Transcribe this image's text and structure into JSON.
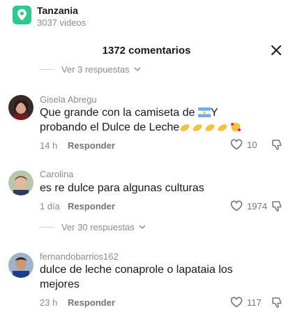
{
  "location": {
    "name": "Tanzania",
    "videos": "3037 videos",
    "icon": "location-pin-icon",
    "accent": "#2ec98f"
  },
  "header": {
    "title": "1372 comentarios",
    "close_icon": "close-icon"
  },
  "replies_top": {
    "label": "Ver 3 respuestas"
  },
  "comments": [
    {
      "username": "Gisela Abregu",
      "text_part1": "Que grande con la camiseta de ",
      "text_part2": "Y",
      "text_line2": "probando el Dulce de Leche",
      "time": "14 h",
      "reply_label": "Responder",
      "likes": "10"
    },
    {
      "username": "Carolina",
      "text": "es re dulce para algunas culturas",
      "time": "1 día",
      "reply_label": "Responder",
      "likes": "1974"
    },
    {
      "username": "fernandobarrios162",
      "text_line1": "dulce de leche conaprole o lapataia los",
      "text_line2": "mejores",
      "time": "23 h",
      "reply_label": "Responder",
      "likes": "117"
    }
  ],
  "replies_mid": {
    "label": "Ver 30 respuestas"
  },
  "colors": {
    "muted": "#8a8b91",
    "text": "#161823"
  }
}
